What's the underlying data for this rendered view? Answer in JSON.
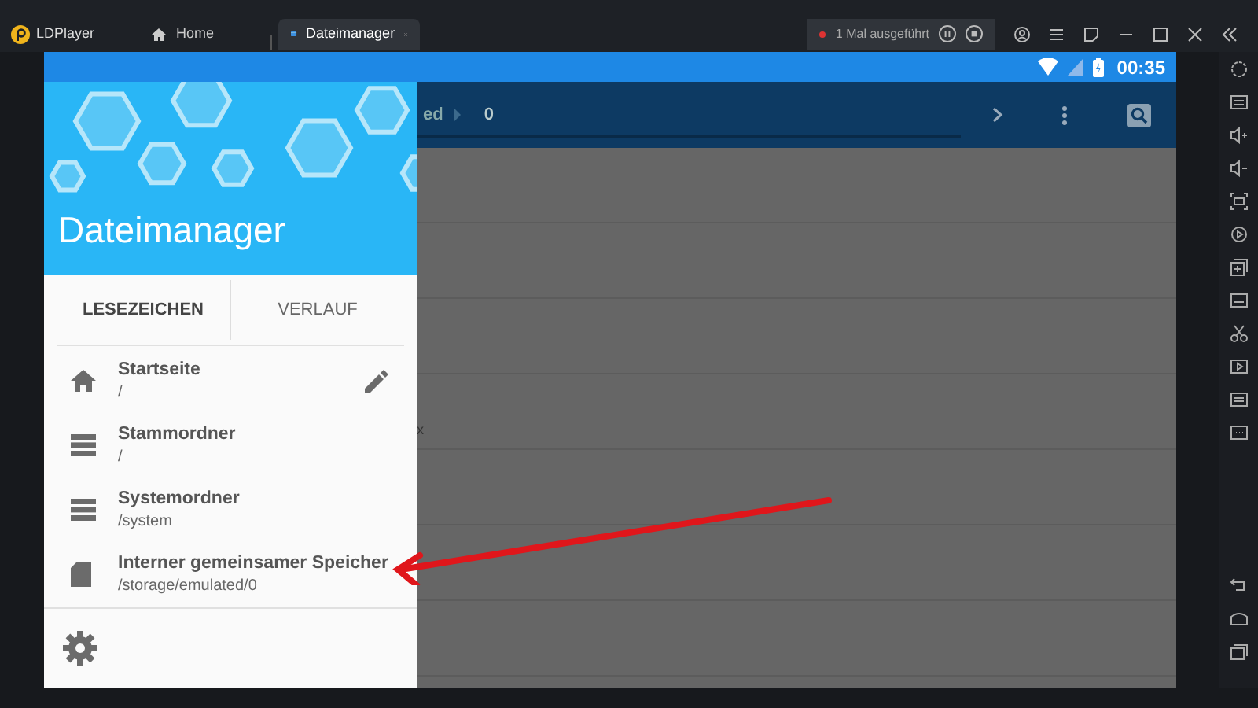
{
  "app_bar": {
    "app_name": "LDPlayer",
    "tabs": [
      {
        "label": "Home",
        "selected": false,
        "kind": "home"
      },
      {
        "label": "Dateimanager",
        "selected": true,
        "kind": "app"
      }
    ],
    "run_status": "1 Mal ausgeführt"
  },
  "status_bar": {
    "time": "00:35"
  },
  "toolbar": {
    "path_tail": "ed",
    "path_item": "0"
  },
  "list": {
    "visible_fragment": "x"
  },
  "drawer": {
    "title": "Dateimanager",
    "tabs": [
      {
        "label": "LESEZEICHEN",
        "selected": true
      },
      {
        "label": "VERLAUF",
        "selected": false
      }
    ],
    "bookmarks": [
      {
        "kind": "home",
        "title": "Startseite",
        "path": "/",
        "editable": true
      },
      {
        "kind": "storage",
        "title": "Stammordner",
        "path": "/",
        "editable": false
      },
      {
        "kind": "storage",
        "title": "Systemordner",
        "path": "/system",
        "editable": false
      },
      {
        "kind": "sdcard",
        "title": "Interner gemeinsamer Speicher",
        "path": "/storage/emulated/0",
        "editable": false
      }
    ]
  }
}
